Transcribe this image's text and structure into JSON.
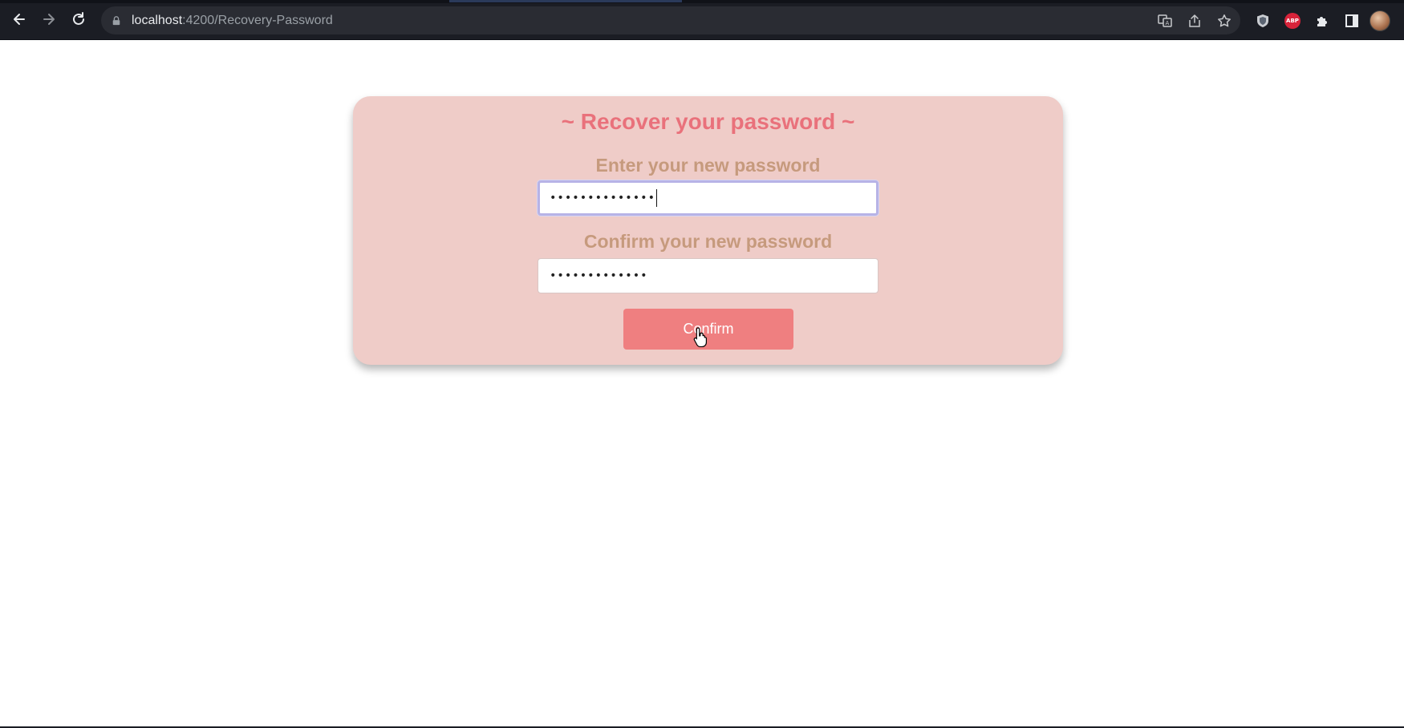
{
  "browser": {
    "url_host": "localhost",
    "url_path": ":4200/Recovery-Password",
    "icons": [
      "back-icon",
      "forward-icon",
      "reload-icon",
      "lock-icon",
      "translate-icon",
      "share-icon",
      "star-icon",
      "shield-icon",
      "abp-icon",
      "puzzle-icon",
      "sidepanel-icon",
      "avatar"
    ],
    "abp_label": "ABP"
  },
  "card": {
    "title": "~ Recover your password ~",
    "new_password_label": "Enter your new password",
    "new_password_value": "••••••••••••••",
    "confirm_password_label": "Confirm your new password",
    "confirm_password_value": "•••••••••••••",
    "confirm_button": "Confirm"
  },
  "colors": {
    "card_bg": "#efccc8",
    "title": "#e9717b",
    "label": "#c69a7d",
    "button": "#ef7f80",
    "focus_ring": "#b7b3e6"
  }
}
